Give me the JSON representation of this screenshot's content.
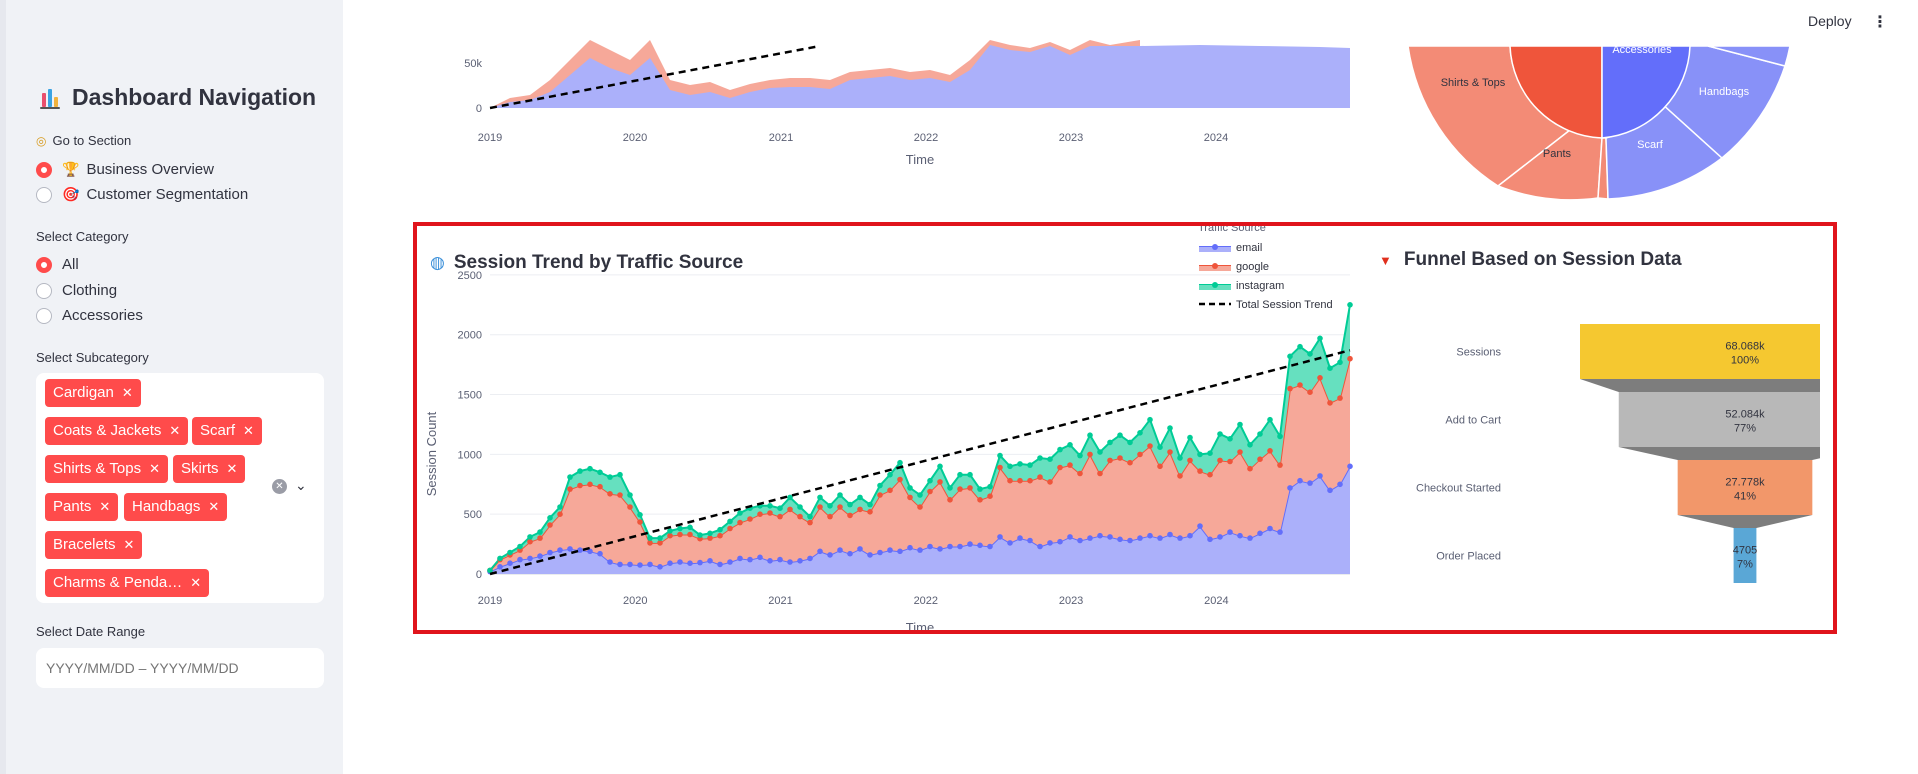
{
  "topbar": {
    "deploy_label": "Deploy",
    "menu_icon": "kebab-menu-icon"
  },
  "sidebar": {
    "title": "Dashboard Navigation",
    "go_to_section": "Go to Section",
    "sections": [
      {
        "label": "Business Overview",
        "selected": true,
        "icon": "trophy-icon"
      },
      {
        "label": "Customer Segmentation",
        "selected": false,
        "icon": "target-icon"
      }
    ],
    "category_label": "Select Category",
    "categories": [
      {
        "label": "All",
        "selected": true
      },
      {
        "label": "Clothing",
        "selected": false
      },
      {
        "label": "Accessories",
        "selected": false
      }
    ],
    "subcategory_label": "Select Subcategory",
    "subcategories": [
      "Cardigan",
      "Coats & Jackets",
      "Scarf",
      "Shirts & Tops",
      "Skirts",
      "Pants",
      "Handbags",
      "Bracelets",
      "Charms & Penda…"
    ],
    "date_range_label": "Select Date Range",
    "date_range_placeholder": "YYYY/MM/DD – YYYY/MM/DD",
    "accent_color": "#ff4b4b"
  },
  "top_chart": {
    "y_ticks": [
      "50k",
      "0"
    ],
    "x_ticks": [
      "2019",
      "2020",
      "2021",
      "2022",
      "2023",
      "2024"
    ],
    "xlabel": "Time"
  },
  "top_pie": {
    "labels": [
      "Shirts & Tops",
      "Accessories",
      "Handbags",
      "Pants",
      "Scarf"
    ]
  },
  "session_trend": {
    "title": "Session Trend by Traffic Source",
    "legend_title": "Traffic Source",
    "legend": [
      "email",
      "google",
      "instagram",
      "Total Session Trend"
    ],
    "ylabel": "Session Count",
    "xlabel": "Time",
    "y_ticks": [
      "2500",
      "2000",
      "1500",
      "1000",
      "500",
      "0"
    ],
    "x_ticks": [
      "2019",
      "2020",
      "2021",
      "2022",
      "2023",
      "2024"
    ]
  },
  "funnel": {
    "title": "Funnel Based on Session Data",
    "stages": [
      {
        "label": "Sessions",
        "value": "68.068k",
        "pct": "100%",
        "color": "#f5c830"
      },
      {
        "label": "Add to Cart",
        "value": "52.084k",
        "pct": "77%",
        "color": "#b8b8b8"
      },
      {
        "label": "Checkout Started",
        "value": "27.778k",
        "pct": "41%",
        "color": "#f2976a"
      },
      {
        "label": "Order Placed",
        "value": "4705",
        "pct": "7%",
        "color": "#5aa7d6"
      }
    ]
  },
  "chart_data": [
    {
      "type": "area",
      "title": "Session Trend by Traffic Source",
      "xlabel": "Time",
      "ylabel": "Session Count",
      "ylim": [
        0,
        2700
      ],
      "x_start": 2019.0,
      "x_end": 2024.92,
      "series": [
        {
          "name": "email",
          "color": "#636efa",
          "values": [
            20,
            60,
            90,
            120,
            130,
            150,
            180,
            200,
            210,
            200,
            190,
            170,
            100,
            80,
            80,
            75,
            80,
            60,
            90,
            100,
            90,
            95,
            110,
            80,
            100,
            130,
            120,
            140,
            110,
            120,
            100,
            110,
            130,
            190,
            160,
            200,
            170,
            210,
            160,
            180,
            200,
            190,
            220,
            200,
            230,
            210,
            230,
            230,
            250,
            240,
            230,
            310,
            260,
            300,
            280,
            230,
            260,
            270,
            310,
            280,
            300,
            320,
            310,
            290,
            280,
            300,
            320,
            300,
            330,
            300,
            320,
            400,
            290,
            310,
            350,
            320,
            300,
            340,
            380,
            350,
            720,
            780,
            760,
            820,
            700,
            750,
            900
          ]
        },
        {
          "name": "google",
          "color": "#ef553b",
          "values": [
            10,
            60,
            70,
            80,
            140,
            150,
            230,
            300,
            500,
            540,
            560,
            560,
            570,
            580,
            480,
            360,
            180,
            200,
            230,
            230,
            240,
            200,
            190,
            240,
            280,
            300,
            340,
            360,
            400,
            360,
            440,
            370,
            300,
            370,
            320,
            360,
            320,
            330,
            360,
            480,
            500,
            600,
            420,
            360,
            460,
            560,
            390,
            480,
            470,
            380,
            420,
            580,
            520,
            480,
            500,
            580,
            510,
            620,
            600,
            560,
            700,
            520,
            640,
            680,
            650,
            700,
            750,
            600,
            690,
            520,
            630,
            460,
            540,
            640,
            590,
            700,
            580,
            620,
            650,
            560,
            830,
            800,
            760,
            820,
            730,
            720,
            900
          ]
        },
        {
          "name": "instagram",
          "color": "#00cc96",
          "values": [
            0,
            10,
            20,
            30,
            40,
            50,
            60,
            60,
            100,
            120,
            130,
            120,
            140,
            170,
            100,
            60,
            40,
            40,
            40,
            50,
            60,
            30,
            40,
            50,
            60,
            80,
            90,
            70,
            60,
            70,
            100,
            80,
            50,
            80,
            90,
            100,
            90,
            100,
            60,
            80,
            130,
            140,
            80,
            100,
            90,
            130,
            100,
            120,
            110,
            90,
            80,
            100,
            120,
            140,
            130,
            160,
            190,
            150,
            170,
            150,
            160,
            180,
            150,
            190,
            170,
            180,
            220,
            160,
            200,
            150,
            190,
            140,
            180,
            220,
            190,
            230,
            200,
            210,
            260,
            240,
            270,
            320,
            320,
            330,
            290,
            300,
            450
          ]
        },
        {
          "name": "Total Session Trend",
          "color": "#000000",
          "values_linear_from_to": [
            0,
            1870
          ]
        }
      ]
    },
    {
      "type": "funnel",
      "title": "Funnel Based on Session Data",
      "categories": [
        "Sessions",
        "Add to Cart",
        "Checkout Started",
        "Order Placed"
      ],
      "values": [
        68068,
        52084,
        27778,
        4705
      ],
      "percent_of_initial": [
        100,
        77,
        41,
        7
      ]
    }
  ]
}
